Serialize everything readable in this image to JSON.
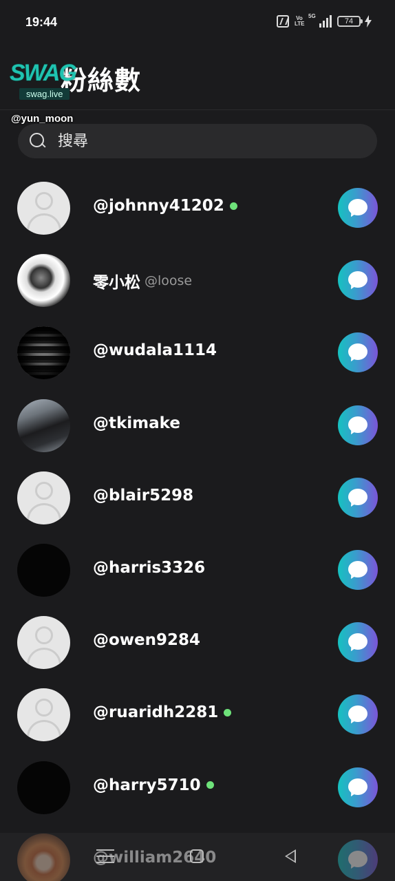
{
  "status_bar": {
    "time": "19:44",
    "network": "5G",
    "battery": "74"
  },
  "header": {
    "title": "粉絲數",
    "logo_text": "SWAG",
    "logo_sub": "swag.live",
    "watermark_user": "@yun_moon"
  },
  "search": {
    "placeholder": "搜尋"
  },
  "followers": [
    {
      "name": "@johnny41202",
      "handle": "",
      "online": true,
      "avatar": "blank"
    },
    {
      "name": "零小松",
      "handle": "@loose",
      "online": false,
      "avatar": "photo-bw"
    },
    {
      "name": "@wudala1114",
      "handle": "",
      "online": false,
      "avatar": "photo-stripes"
    },
    {
      "name": "@tkimake",
      "handle": "",
      "online": false,
      "avatar": "photo-dark"
    },
    {
      "name": "@blair5298",
      "handle": "",
      "online": false,
      "avatar": "blank"
    },
    {
      "name": "@harris3326",
      "handle": "",
      "online": false,
      "avatar": "black"
    },
    {
      "name": "@owen9284",
      "handle": "",
      "online": false,
      "avatar": "blank"
    },
    {
      "name": "@ruaridh2281",
      "handle": "",
      "online": true,
      "avatar": "blank"
    },
    {
      "name": "@harry5710",
      "handle": "",
      "online": true,
      "avatar": "black"
    },
    {
      "name": "@william2640",
      "handle": "",
      "online": false,
      "avatar": "photo-orange"
    }
  ],
  "icons": {
    "chat": "chat-bubble-icon",
    "search": "search-icon",
    "online": "online-dot-icon"
  },
  "colors": {
    "background": "#1b1b1d",
    "online": "#6ee27a",
    "chat_gradient_start": "#16c2c0",
    "chat_gradient_end": "#7b55d8",
    "logo": "#1fc3b0"
  }
}
